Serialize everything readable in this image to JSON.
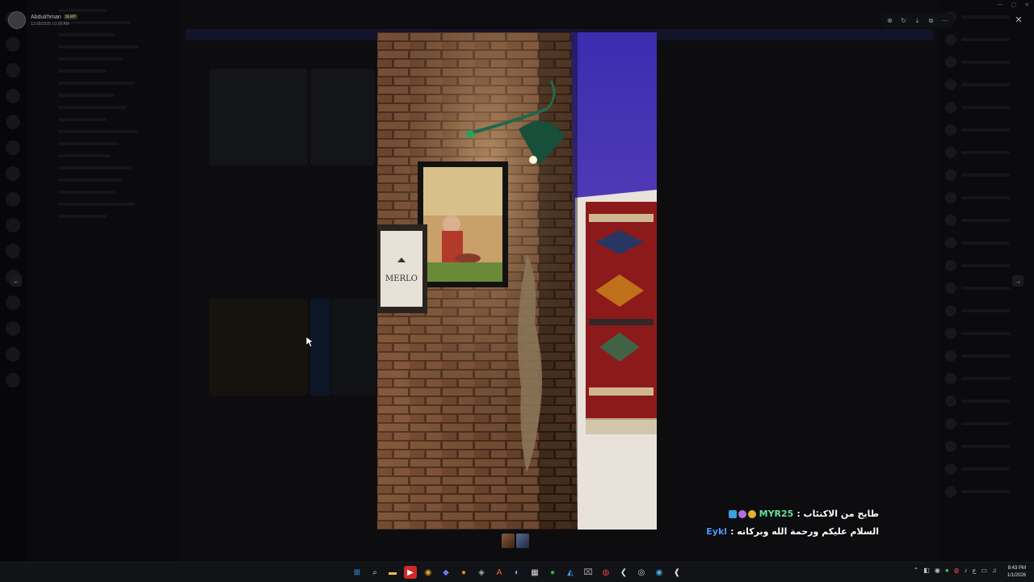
{
  "uploader": {
    "name": "Abdulrhman",
    "badge": "SLRP",
    "date": "12/28/2025 10:16 AM"
  },
  "viewer_toolbar": {
    "icons": [
      "zoom-in-icon",
      "rotate-icon",
      "download-icon",
      "open-external-icon",
      "more-icon"
    ]
  },
  "photo": {
    "sign_text": "MERLO"
  },
  "overlay": {
    "line1_code": "MYR25",
    "line1_text": "طايح من الاكتئاب : ",
    "line2_name": "Eykl",
    "line2_text": "السلام عليكم ورحمة الله وبركاته : "
  },
  "taskbar": {
    "time": "8:43 PM",
    "date": "1/1/2026"
  },
  "colors": {
    "overlay_code": "#5fe8a0",
    "overlay_name": "#4d9df5"
  }
}
